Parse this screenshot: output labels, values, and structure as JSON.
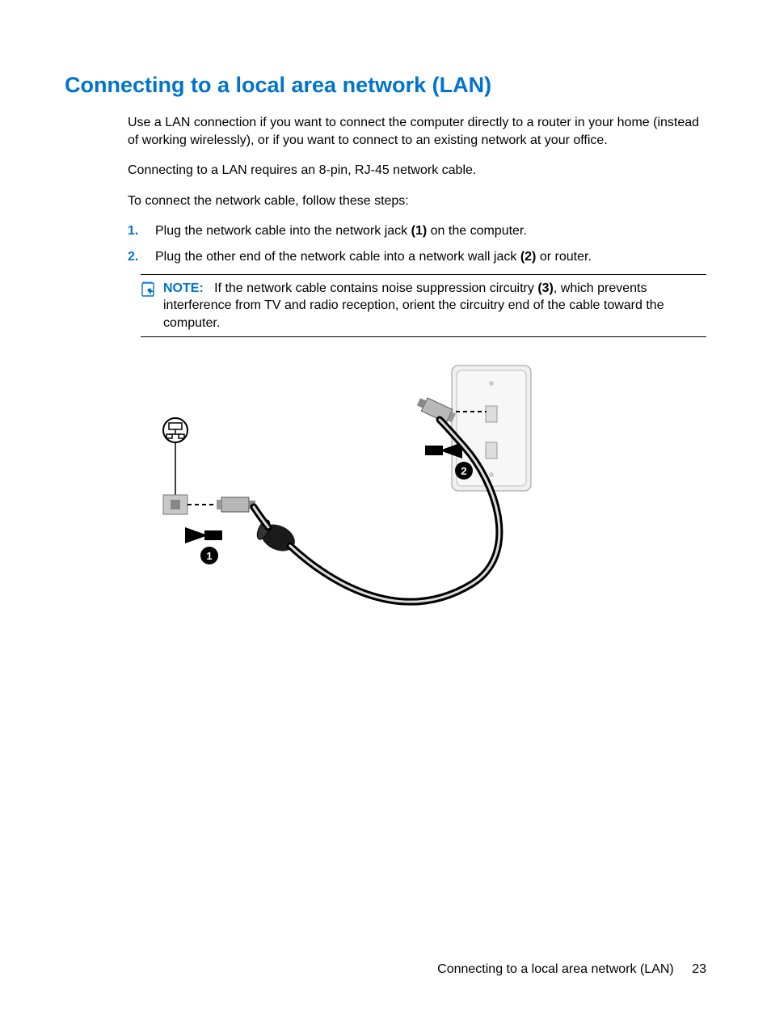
{
  "heading": "Connecting to a local area network (LAN)",
  "intro1": "Use a LAN connection if you want to connect the computer directly to a router in your home (instead of working wirelessly), or if you want to connect to an existing network at your office.",
  "intro2": "Connecting to a LAN requires an 8-pin, RJ-45 network cable.",
  "intro3": "To connect the network cable, follow these steps:",
  "steps": {
    "n1": "1.",
    "s1a": "Plug the network cable into the network jack ",
    "s1b": "(1)",
    "s1c": " on the computer.",
    "n2": "2.",
    "s2a": "Plug the other end of the network cable into a network wall jack ",
    "s2b": "(2)",
    "s2c": " or router."
  },
  "note": {
    "label": "NOTE:",
    "a": "If the network cable contains noise suppression circuitry ",
    "b": "(3)",
    "c": ", which prevents interference from TV and radio reception, orient the circuitry end of the cable toward the computer."
  },
  "footer": {
    "title": "Connecting to a local area network (LAN)",
    "page": "23"
  }
}
